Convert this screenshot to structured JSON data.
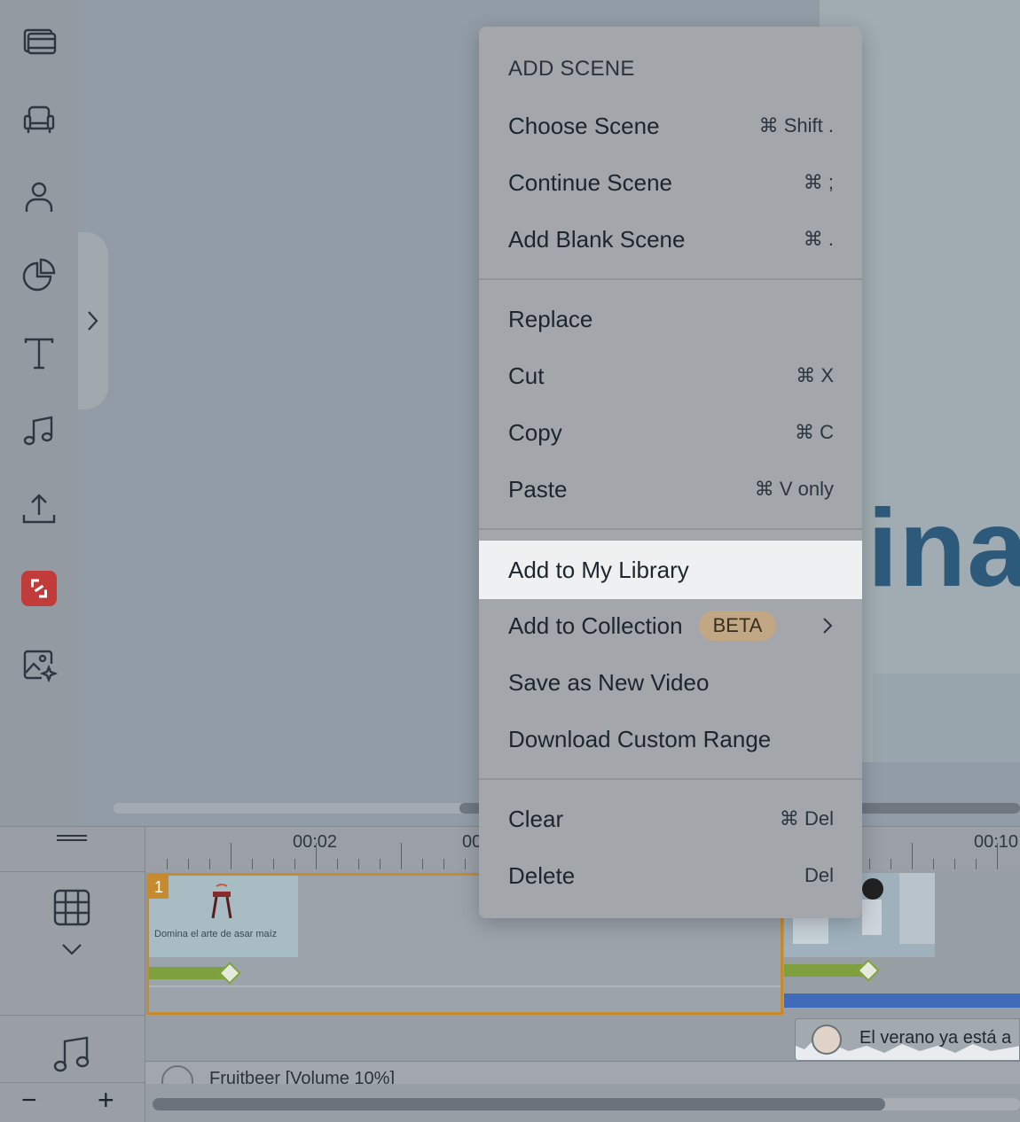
{
  "sidebar": {
    "items": [
      {
        "icon": "film-strip-icon"
      },
      {
        "icon": "armchair-icon"
      },
      {
        "icon": "user-icon"
      },
      {
        "icon": "pie-chart-icon"
      },
      {
        "icon": "text-icon"
      },
      {
        "icon": "music-note-icon"
      },
      {
        "icon": "upload-icon"
      },
      {
        "icon": "brand-logo-icon"
      },
      {
        "icon": "ai-image-icon"
      }
    ]
  },
  "stage": {
    "visible_text": "ina"
  },
  "context_menu": {
    "heading": "ADD SCENE",
    "items": [
      {
        "label": "Choose Scene",
        "shortcut": "⌘ Shift ."
      },
      {
        "label": "Continue Scene",
        "shortcut": "⌘ ;"
      },
      {
        "label": "Add Blank Scene",
        "shortcut": "⌘ ."
      },
      {
        "label": "Replace",
        "shortcut": ""
      },
      {
        "label": "Cut",
        "shortcut": "⌘ X"
      },
      {
        "label": "Copy",
        "shortcut": "⌘ C"
      },
      {
        "label": "Paste",
        "shortcut": "⌘ V only"
      },
      {
        "label": "Add to My Library",
        "shortcut": ""
      },
      {
        "label": "Add to Collection",
        "badge": "BETA"
      },
      {
        "label": "Save as New Video",
        "shortcut": ""
      },
      {
        "label": "Download Custom Range",
        "shortcut": ""
      },
      {
        "label": "Clear",
        "shortcut": "⌘ Del"
      },
      {
        "label": "Delete",
        "shortcut": "Del"
      }
    ],
    "highlighted": "Add to My Library"
  },
  "timeline": {
    "ruler_labels": [
      "00:02",
      "00",
      "00:10"
    ],
    "scene1": {
      "number": "1",
      "caption": "Domina el arte de asar maíz"
    },
    "audio_clip_label": "El verano ya está a",
    "music_track_label": "Fruitbeer [Volume 10%]",
    "zoom_out": "−",
    "zoom_in": "+"
  },
  "colors": {
    "scene_border": "#c88a2f",
    "keyframe_green": "#7fa03e",
    "voice_blue": "#3f6bb8",
    "menu_highlight": "#eef0f2",
    "beta_badge": "#c1a783"
  }
}
